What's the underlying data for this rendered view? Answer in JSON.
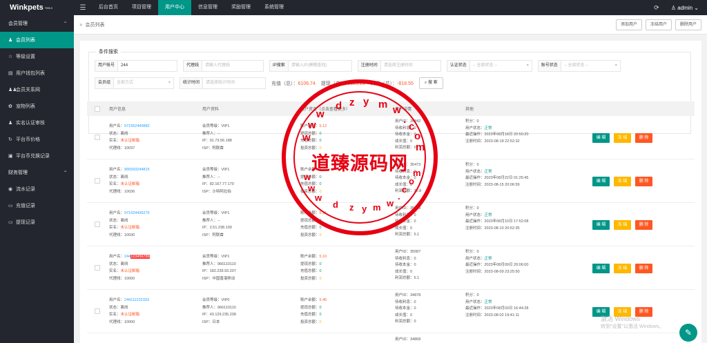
{
  "app": {
    "logo": "Winkpets",
    "logo_sup": "TM6.0",
    "menu_icon": "☰"
  },
  "topnav": [
    "后台首页",
    "项目管理",
    "用户中心",
    "信息管理",
    "奖励管理",
    "系统管理"
  ],
  "top_right": {
    "refresh_icon": "⟳",
    "user": "♙ admin",
    "user_chevron": "⌄"
  },
  "sidebar": {
    "groups": [
      {
        "label": "会员管理",
        "items": [
          "会员列表",
          "等级设置",
          "用户钱包列表",
          "会员关系网",
          "宠物列表",
          "实名认证审核",
          "平台币价格",
          "平台币兑换记录"
        ]
      },
      {
        "label": "财务管理",
        "items": [
          "流水记录",
          "充值记录",
          "提现记录"
        ]
      }
    ],
    "icons": [
      "♟",
      "☆",
      "▤",
      "♟♟",
      "✿",
      "♟",
      "↻",
      "▣",
      "◉",
      "▭",
      "▭"
    ]
  },
  "breadcrumb": {
    "arrow": "»",
    "current": "会员列表"
  },
  "actions": {
    "add": "添加用户",
    "freeze": "冻结用户",
    "delete": "删除用户"
  },
  "filter": {
    "legend": "条件搜索",
    "account_label": "用户帐号",
    "account_value": "244",
    "agent_label": "代理线",
    "agent_placeholder": "请输入代理线",
    "ip_label": "IP搜索",
    "ip_placeholder": "请输入IP(模糊查找)",
    "reg_label": "注册时间",
    "reg_placeholder": "请选择注册时间",
    "auth_label": "认证状态",
    "auth_placeholder": "-- 全部状态 --",
    "acct_status_label": "账号状态",
    "acct_status_placeholder": "-- 全部状态 --",
    "group_label": "会员组",
    "group_placeholder": "全部方式",
    "stat_time_label": "统计时间",
    "stat_time_placeholder": "请选择统计时间",
    "deposit_label": "充值（总）：",
    "deposit_value": "6106.74",
    "withdraw_label": "提现（总）：",
    "withdraw_value": "6925.29",
    "profit_label": "利润（总）：",
    "profit_value": "-818.55",
    "search_button": "搜 索",
    "search_icon": "⌕",
    "dropdown_icon": "▾"
  },
  "table": {
    "headers": [
      "用户信息",
      "用户资料",
      "用户资金（点击查看更多）",
      "资产详情",
      "其他"
    ],
    "op_labels": {
      "edit": "编 辑",
      "freeze": "冻 结",
      "delete": "删 除"
    },
    "rows": [
      {
        "info": [
          "用户名：",
          "971552440882",
          "状态：离线",
          "实名：",
          "未认证邮箱",
          "代理线：10037"
        ],
        "profile": [
          "会员等级：VIP1",
          "推荐人：--",
          "IP：91.73.56.188",
          "ISP：阿联酋"
        ],
        "funds": [
          "账户余额：",
          "5.12",
          "提现总额：",
          "0",
          "充值总额：",
          "0",
          "投资总额：",
          "0"
        ],
        "assets": [
          "用户ID：35842",
          "待收利息：0",
          "待收本金：0",
          "成长值：0",
          "利润总额：0"
        ],
        "other": [
          "积分：0",
          "用户状态：",
          "正常",
          "最近操作：2023年08月18日 20:50:20",
          "注册时间：2023-08-18 22:52:32"
        ]
      },
      {
        "info": [
          "用户名：",
          "966593244815",
          "状态：离线",
          "实名：",
          "未认证邮箱",
          "代理线：10036"
        ],
        "profile": [
          "会员等级：VIP1",
          "推荐人：--",
          "IP：82.167.77.179",
          "ISP：沙特阿拉伯"
        ],
        "funds": [
          "账户余额：",
          "5.07",
          "提现总额：",
          "0",
          "充值总额：",
          "0",
          "投资总额：",
          "0"
        ],
        "assets": [
          "用户ID：35473",
          "待收利息：0",
          "待收本金：0",
          "成长值：0",
          "利润总额：30.8"
        ],
        "other": [
          "积分：0",
          "用户状态：",
          "正常",
          "最近操作：2023年08月22日 01:25:45",
          "注册时间：2023-08-15 20:06:59"
        ]
      },
      {
        "info": [
          "用户名：",
          "971524436276",
          "状态：离线",
          "实名：",
          "未认证邮箱",
          "代理线：10030"
        ],
        "profile": [
          "会员等级：VIP1",
          "推荐人：--",
          "IP：2.51.238.109",
          "ISP：阿联酋"
        ],
        "funds": [
          "账户余额：",
          "5.11",
          "提现总额：",
          "0",
          "充值总额：",
          "0",
          "投资总额：",
          "0"
        ],
        "assets": [
          "用户ID：35379",
          "待收利息：0",
          "待收本金：0",
          "成长值：0",
          "利润总额：5.1"
        ],
        "other": [
          "积分：0",
          "用户状态：",
          "正常",
          "最近操作：2023年08月10日 17:52:08",
          "注册时间：2023-08-10 20:52:35"
        ]
      },
      {
        "info": [
          "用户名：",
          "244",
          "123456789",
          "状态：离线",
          "实名：",
          "未认证邮箱",
          "代理线：10000"
        ],
        "profile": [
          "会员等级：VIP1",
          "推荐人：966110110",
          "IP：182.239.93.207",
          "ISP：中国香港移动"
        ],
        "funds": [
          "账户余额：",
          "5.10",
          "提现总额：",
          "0",
          "充值总额：",
          "0",
          "投资总额：",
          "0"
        ],
        "assets": [
          "用户ID：35087",
          "待收利息：0",
          "待收本金：0",
          "成长值：0",
          "利润总额：5.1"
        ],
        "other": [
          "积分：0",
          "用户状态：",
          "正常",
          "最近操作：2023年08月09日 20:06:00",
          "注册时间：2023-08-09 23:25:50"
        ]
      },
      {
        "info": [
          "用户名：",
          "244111222333",
          "状态：离线",
          "实名：",
          "未认证邮箱",
          "代理线：10000"
        ],
        "profile": [
          "会员等级：VIP0",
          "推荐人：966110110",
          "IP：43.129.235.238",
          "ISP：日本"
        ],
        "funds": [
          "账户余额：",
          "5.40",
          "提现总额：",
          "0",
          "充值总额：",
          "0",
          "投资总额：",
          "0"
        ],
        "assets": [
          "用户ID：34878",
          "待收利息：0",
          "待收本金：0",
          "成长值：0",
          "利润总额：0"
        ],
        "other": [
          "积分：0",
          "用户状态：",
          "正常",
          "最近操作：2023年08月03日 16:44:28",
          "注册时间：2023-08-02 19:41:11"
        ]
      }
    ],
    "partial_row": {
      "user_id": "用户ID：34868"
    }
  },
  "watermark": {
    "center": "道臻源码网",
    "top_letters": "w w w d z y m w . c o m",
    "bottom_letters": "w w w d z y m w . c o m"
  },
  "activation": {
    "line1": "激活 Windows",
    "line2": "转到\"设置\"以激活 Windows。"
  },
  "chat_icon": "✎"
}
